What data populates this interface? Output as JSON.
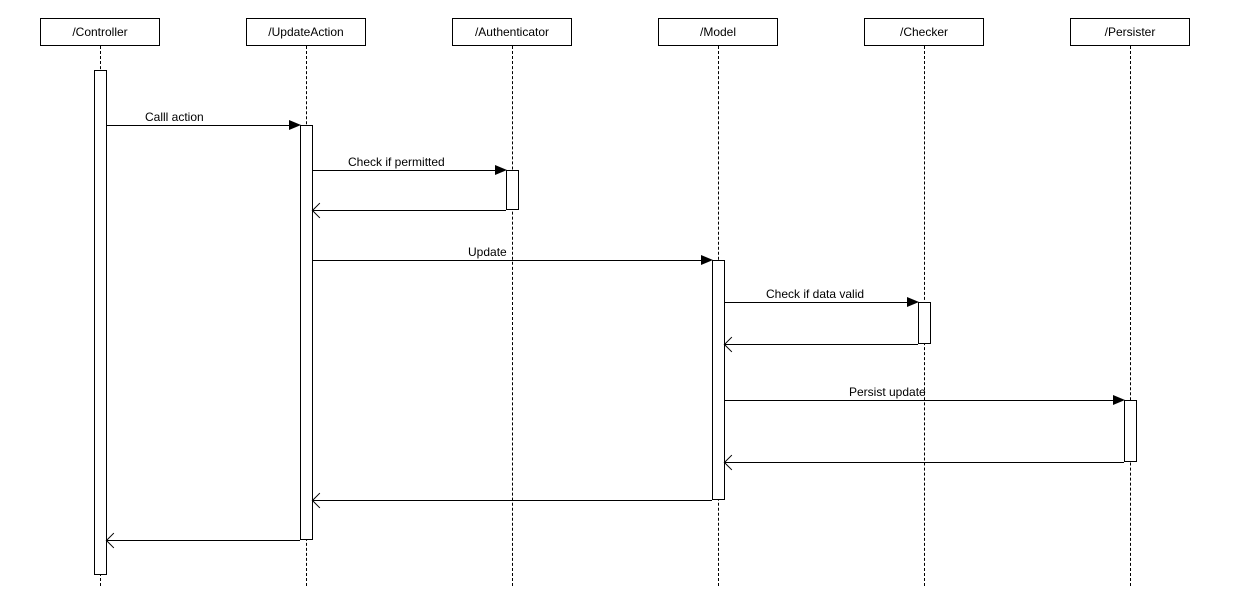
{
  "lifelines": {
    "controller": "/Controller",
    "updateAction": "/UpdateAction",
    "authenticator": "/Authenticator",
    "model": "/Model",
    "checker": "/Checker",
    "persister": "/Persister"
  },
  "messages": {
    "callAction": "Calll action",
    "checkPermitted": "Check if permitted",
    "update": "Update",
    "checkDataValid": "Check if data valid",
    "persistUpdate": "Persist update"
  }
}
